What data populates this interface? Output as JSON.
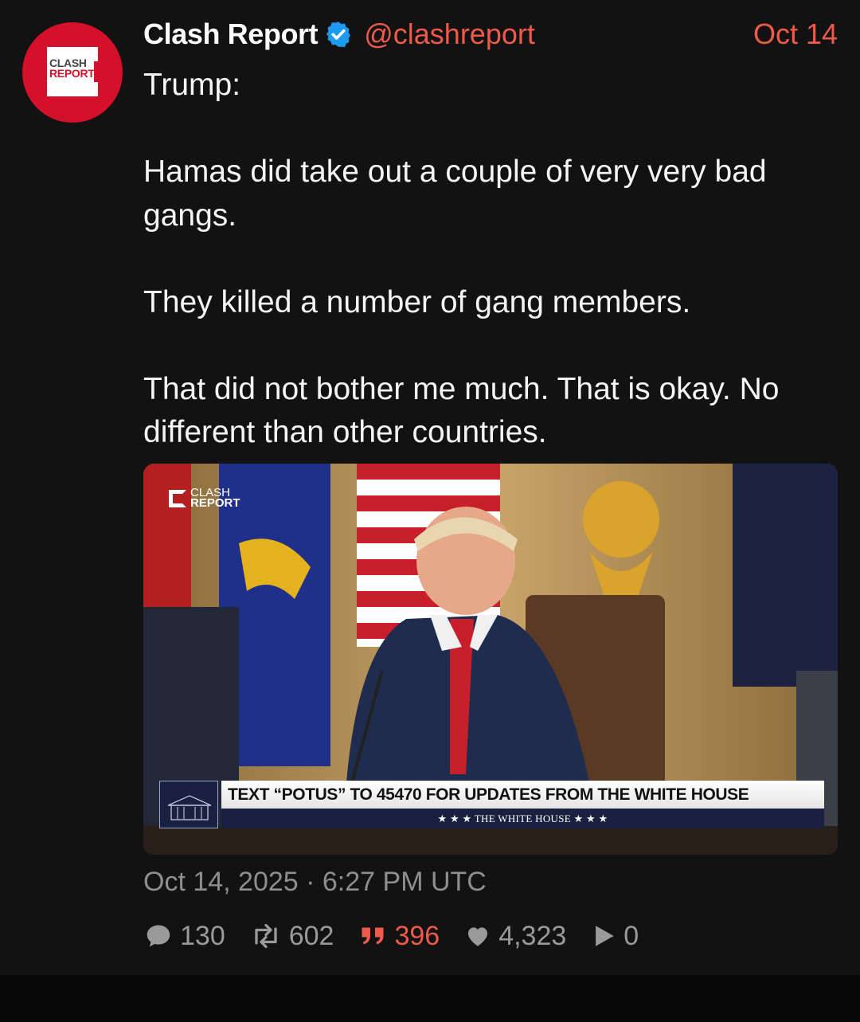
{
  "post": {
    "author_name": "Clash Report",
    "handle": "@clashreport",
    "date_short": "Oct 14",
    "avatar_text": [
      "CLASH",
      "REPORT"
    ],
    "paragraphs": [
      "Trump:",
      "Hamas did take out a couple of very very bad gangs.",
      "They killed a number of gang members.",
      "That did not bother me much. That is okay. No different than other countries."
    ],
    "timestamp": "Oct 14, 2025 · 6:27 PM UTC",
    "media": {
      "watermark": [
        "CLASH",
        "REPORT"
      ],
      "lower_third_main": "TEXT “POTUS” TO 45470 FOR UPDATES FROM THE WHITE HOUSE",
      "lower_third_sub": "★ ★ ★   THE WHITE HOUSE   ★ ★ ★"
    }
  },
  "actions": {
    "replies": "130",
    "reposts": "602",
    "quotes": "396",
    "likes": "4,323",
    "views": "0"
  },
  "colors": {
    "background": "#121212",
    "accent": "#f15a4a",
    "muted": "#8e8e8e",
    "verified": "#1d9bf0"
  },
  "icons": [
    "verified-badge-icon",
    "reply-icon",
    "repost-icon",
    "quote-icon",
    "heart-icon",
    "play-icon"
  ]
}
